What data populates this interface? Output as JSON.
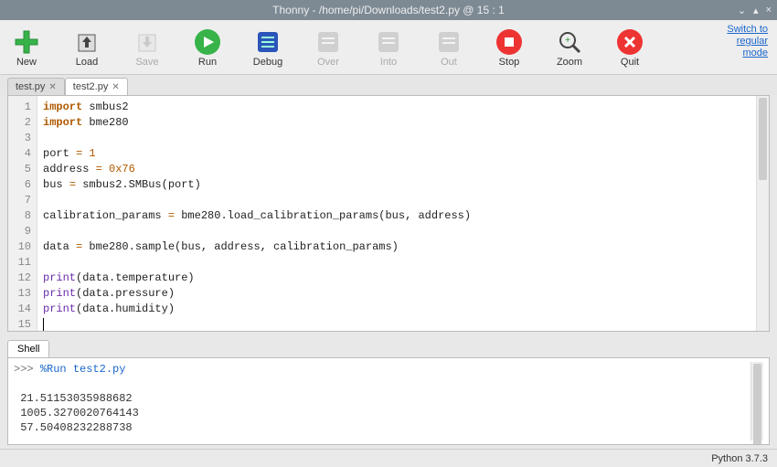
{
  "window": {
    "title": "Thonny  -  /home/pi/Downloads/test2.py  @  15 : 1"
  },
  "toolbar": {
    "new": "New",
    "load": "Load",
    "save": "Save",
    "run": "Run",
    "debug": "Debug",
    "over": "Over",
    "into": "Into",
    "out": "Out",
    "stop": "Stop",
    "zoom": "Zoom",
    "quit": "Quit"
  },
  "top_link": {
    "l1": "Switch to",
    "l2": "regular",
    "l3": "mode"
  },
  "tabs": [
    {
      "label": "test.py"
    },
    {
      "label": "test2.py"
    }
  ],
  "code": {
    "lines": [
      {
        "n": "1",
        "tokens": [
          {
            "t": "import",
            "c": "kw"
          },
          {
            "t": " smbus2",
            "c": "ident"
          }
        ]
      },
      {
        "n": "2",
        "tokens": [
          {
            "t": "import",
            "c": "kw"
          },
          {
            "t": " bme280",
            "c": "ident"
          }
        ]
      },
      {
        "n": "3",
        "tokens": []
      },
      {
        "n": "4",
        "tokens": [
          {
            "t": "port ",
            "c": "ident"
          },
          {
            "t": "=",
            "c": "op"
          },
          {
            "t": " ",
            "c": "ident"
          },
          {
            "t": "1",
            "c": "num"
          }
        ]
      },
      {
        "n": "5",
        "tokens": [
          {
            "t": "address ",
            "c": "ident"
          },
          {
            "t": "=",
            "c": "op"
          },
          {
            "t": " ",
            "c": "ident"
          },
          {
            "t": "0x76",
            "c": "num"
          }
        ]
      },
      {
        "n": "6",
        "tokens": [
          {
            "t": "bus ",
            "c": "ident"
          },
          {
            "t": "=",
            "c": "op"
          },
          {
            "t": " smbus2.SMBus(port)",
            "c": "ident"
          }
        ]
      },
      {
        "n": "7",
        "tokens": []
      },
      {
        "n": "8",
        "tokens": [
          {
            "t": "calibration_params ",
            "c": "ident"
          },
          {
            "t": "=",
            "c": "op"
          },
          {
            "t": " bme280.load_calibration_params(bus, address)",
            "c": "ident"
          }
        ]
      },
      {
        "n": "9",
        "tokens": []
      },
      {
        "n": "10",
        "tokens": [
          {
            "t": "data ",
            "c": "ident"
          },
          {
            "t": "=",
            "c": "op"
          },
          {
            "t": " bme280.sample(bus, address, calibration_params)",
            "c": "ident"
          }
        ]
      },
      {
        "n": "11",
        "tokens": []
      },
      {
        "n": "12",
        "tokens": [
          {
            "t": "print",
            "c": "fn"
          },
          {
            "t": "(data.temperature)",
            "c": "ident"
          }
        ]
      },
      {
        "n": "13",
        "tokens": [
          {
            "t": "print",
            "c": "fn"
          },
          {
            "t": "(data.pressure)",
            "c": "ident"
          }
        ]
      },
      {
        "n": "14",
        "tokens": [
          {
            "t": "print",
            "c": "fn"
          },
          {
            "t": "(data.humidity)",
            "c": "ident"
          }
        ]
      },
      {
        "n": "15",
        "tokens": []
      }
    ]
  },
  "shell": {
    "tab": "Shell",
    "run_cmd": "%Run test2.py",
    "outputs": [
      "21.51153035988682",
      "1005.3270020764143",
      "57.50408232288738"
    ],
    "prompt": ">>>"
  },
  "status": {
    "python": "Python 3.7.3"
  }
}
